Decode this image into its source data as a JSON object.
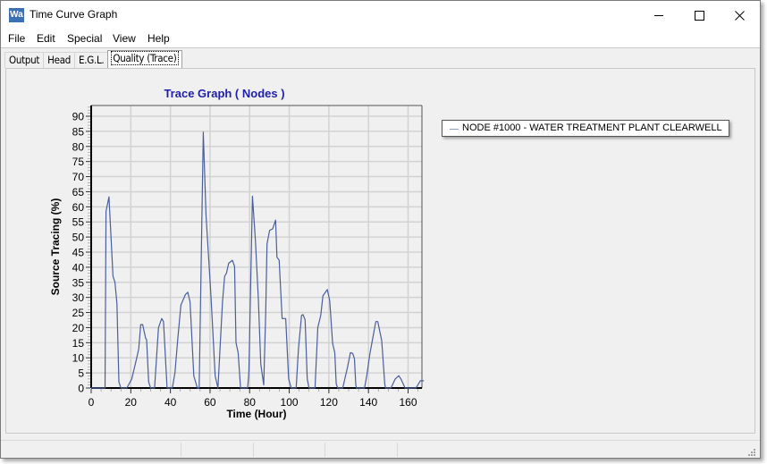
{
  "window": {
    "app_icon_text": "Wa",
    "title": "Time Curve Graph",
    "controls": {
      "minimize": "minimize",
      "maximize": "maximize",
      "close": "close"
    }
  },
  "menu": [
    "File",
    "Edit",
    "Special",
    "View",
    "Help"
  ],
  "tabs": [
    {
      "label": "Output",
      "active": false
    },
    {
      "label": "Head",
      "active": false
    },
    {
      "label": "E.G.L.",
      "active": false
    },
    {
      "label": "Quality (Trace)",
      "active": true
    }
  ],
  "colors": {
    "title": "#1f1fa8",
    "series": "#4a5f9a",
    "grid": "#d2d2d2",
    "plot_bg": "#f0f0f0"
  },
  "chart_data": {
    "type": "line",
    "title": "Trace Graph ( Nodes )",
    "xlabel": "Time (Hour)",
    "ylabel": "Source Tracing (%)",
    "xlim": [
      0,
      168
    ],
    "ylim": [
      0,
      93
    ],
    "xticks": [
      0,
      20,
      40,
      60,
      80,
      100,
      120,
      140,
      160
    ],
    "yticks": [
      0,
      5,
      10,
      15,
      20,
      25,
      30,
      35,
      40,
      45,
      50,
      55,
      60,
      65,
      70,
      75,
      80,
      85,
      90
    ],
    "grid": true,
    "legend_position": "right",
    "series": [
      {
        "name": "NODE #1000 - WATER TREATMENT PLANT CLEARWELL",
        "x": [
          0,
          7,
          7.5,
          9,
          11,
          12,
          13,
          14,
          15,
          18,
          20.5,
          23,
          24,
          25,
          26,
          27.5,
          28,
          29,
          30,
          32,
          34,
          35.6,
          36.5,
          38.3,
          41,
          42.3,
          43.8,
          45.3,
          47.6,
          48.8,
          49.9,
          51.8,
          53.6,
          54.5,
          56.6,
          58,
          60.4,
          62.6,
          64,
          66.3,
          67.4,
          68.3,
          69.4,
          71.3,
          72.4,
          73.1,
          74.2,
          75.4,
          79,
          79.6,
          81.4,
          82.9,
          84.4,
          85.6,
          87.1,
          88.1,
          88.8,
          90.1,
          91.6,
          93.1,
          93.8,
          94.9,
          96.4,
          98.2,
          99.7,
          101,
          103.5,
          104.6,
          106.2,
          106.9,
          108,
          109.1,
          110,
          113,
          114.4,
          115.9,
          117,
          119.2,
          120.4,
          121.9,
          123,
          123.7,
          124.5,
          127,
          129.4,
          130.9,
          132,
          132.9,
          133.6,
          134,
          138,
          139.2,
          140.7,
          142.2,
          143.7,
          144.7,
          146.7,
          148.2,
          148.6,
          151.4,
          153.5,
          155.3,
          156.4,
          158.2,
          158.5,
          164,
          166.2,
          168
        ],
        "y": [
          0,
          0,
          58.5,
          63.3,
          37,
          35,
          28,
          2,
          0,
          0,
          3,
          10,
          13,
          21,
          21,
          16.5,
          16,
          2,
          0,
          0,
          20,
          23,
          22,
          0,
          0,
          5,
          16.7,
          27.5,
          31,
          31.7,
          28.5,
          4,
          0,
          0,
          84.7,
          57,
          31.5,
          4,
          0,
          28.5,
          37,
          38,
          41.3,
          42.3,
          40.3,
          15,
          11.7,
          0,
          0,
          5,
          63.5,
          49,
          29.5,
          8,
          1,
          24.5,
          47.7,
          52.2,
          52.7,
          55.6,
          43.3,
          42.3,
          23,
          23,
          3,
          0,
          0,
          12.7,
          24,
          24.3,
          22.6,
          3,
          0,
          0,
          20,
          24,
          30.5,
          32.6,
          29,
          14.7,
          11.7,
          1.4,
          0,
          0,
          6.8,
          11.7,
          11.5,
          9.7,
          1,
          0,
          0,
          4.3,
          11.2,
          16.7,
          22,
          22,
          15.7,
          1.4,
          0,
          0,
          3,
          4.1,
          3,
          0.4,
          0,
          0,
          2.4,
          2.4
        ]
      }
    ]
  },
  "statusbar": {
    "panels": [
      "",
      "",
      "",
      "",
      ""
    ]
  }
}
